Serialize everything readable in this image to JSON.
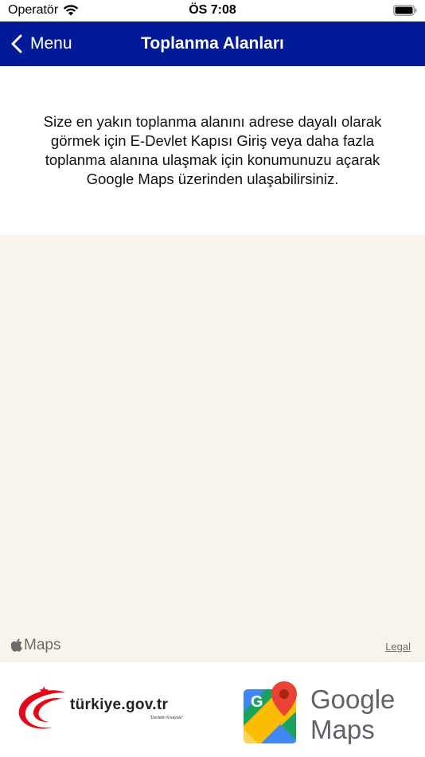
{
  "status_bar": {
    "carrier": "Operatör",
    "time": "ÖS 7:08"
  },
  "nav": {
    "back_label": "Menu",
    "title": "Toplanma Alanları",
    "background": "#021a97"
  },
  "info": {
    "text": "Size en yakın toplanma alanını adrese dayalı olarak görmek için E-Devlet Kapısı Giriş veya daha fazla toplanma alanına ulaşmak için konumunuzu açarak Google Maps üzerinden ulaşabilirsiniz."
  },
  "map": {
    "attribution": "Maps",
    "legal_label": "Legal",
    "background": "#f8f4ec"
  },
  "footer": {
    "edevlet_logo_text": "türkiye.gov.tr",
    "edevlet_slogan": "\"Devletin Kısayolu\"",
    "google_maps_line1": "Google",
    "google_maps_line2": "Maps"
  }
}
